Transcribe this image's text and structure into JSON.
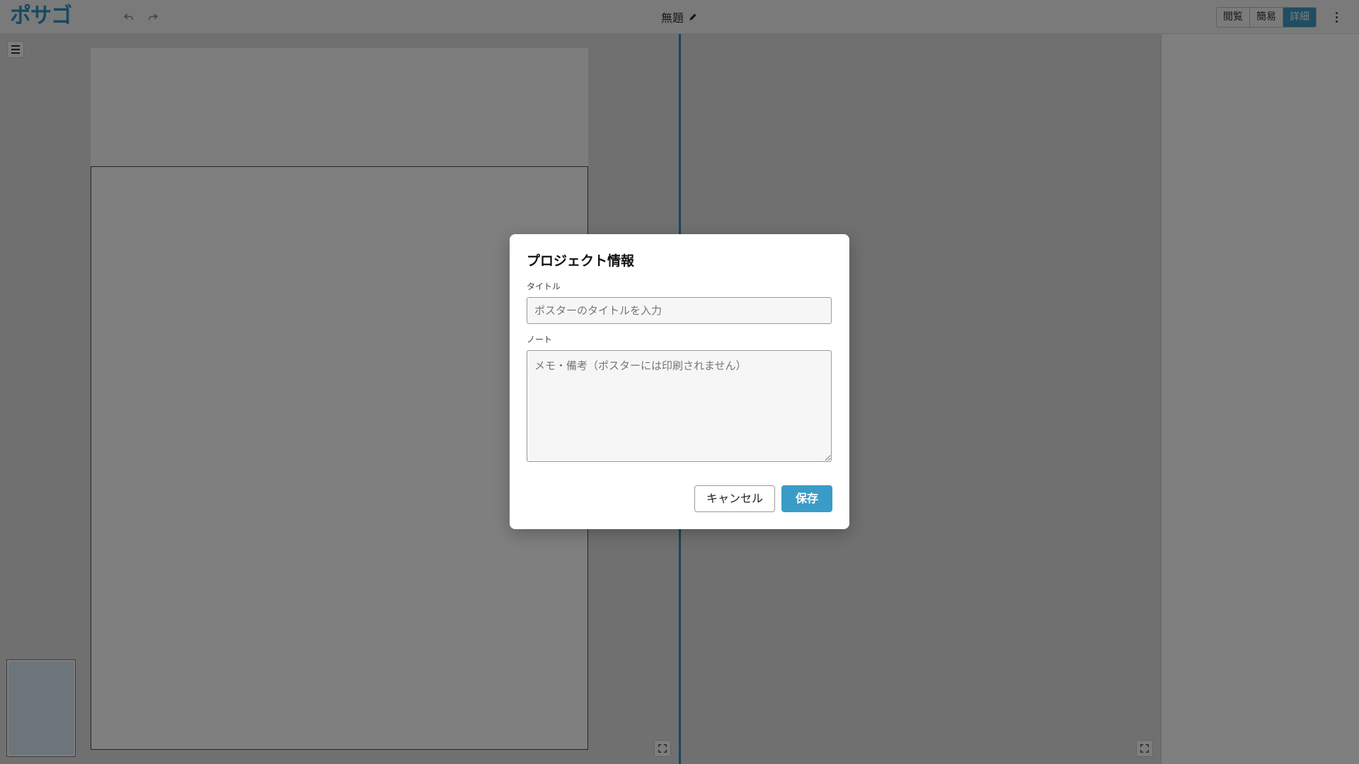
{
  "app": {
    "logo_text": "ポサゴ",
    "undo_icon": "undo-icon",
    "redo_icon": "redo-icon"
  },
  "header": {
    "document_title": "無題",
    "edit_icon": "pencil-icon",
    "modes": [
      "閲覧",
      "簡易",
      "詳細"
    ],
    "active_mode": "詳細",
    "more_icon": "kebab-menu-icon"
  },
  "dialog": {
    "title": "プロジェクト情報",
    "title_label": "タイトル",
    "title_value": "",
    "title_placeholder": "ポスターのタイトルを入力",
    "note_label": "ノート",
    "note_value": "",
    "note_placeholder": "メモ・備考（ポスターには印刷されません）",
    "cancel_label": "キャンセル",
    "save_label": "保存"
  },
  "colors": {
    "accent": "#3a9cc6",
    "logo_secondary": "#4fb8a6",
    "split_line": "#2f8fbf",
    "overlay": "rgba(0,0,0,0.5)"
  }
}
